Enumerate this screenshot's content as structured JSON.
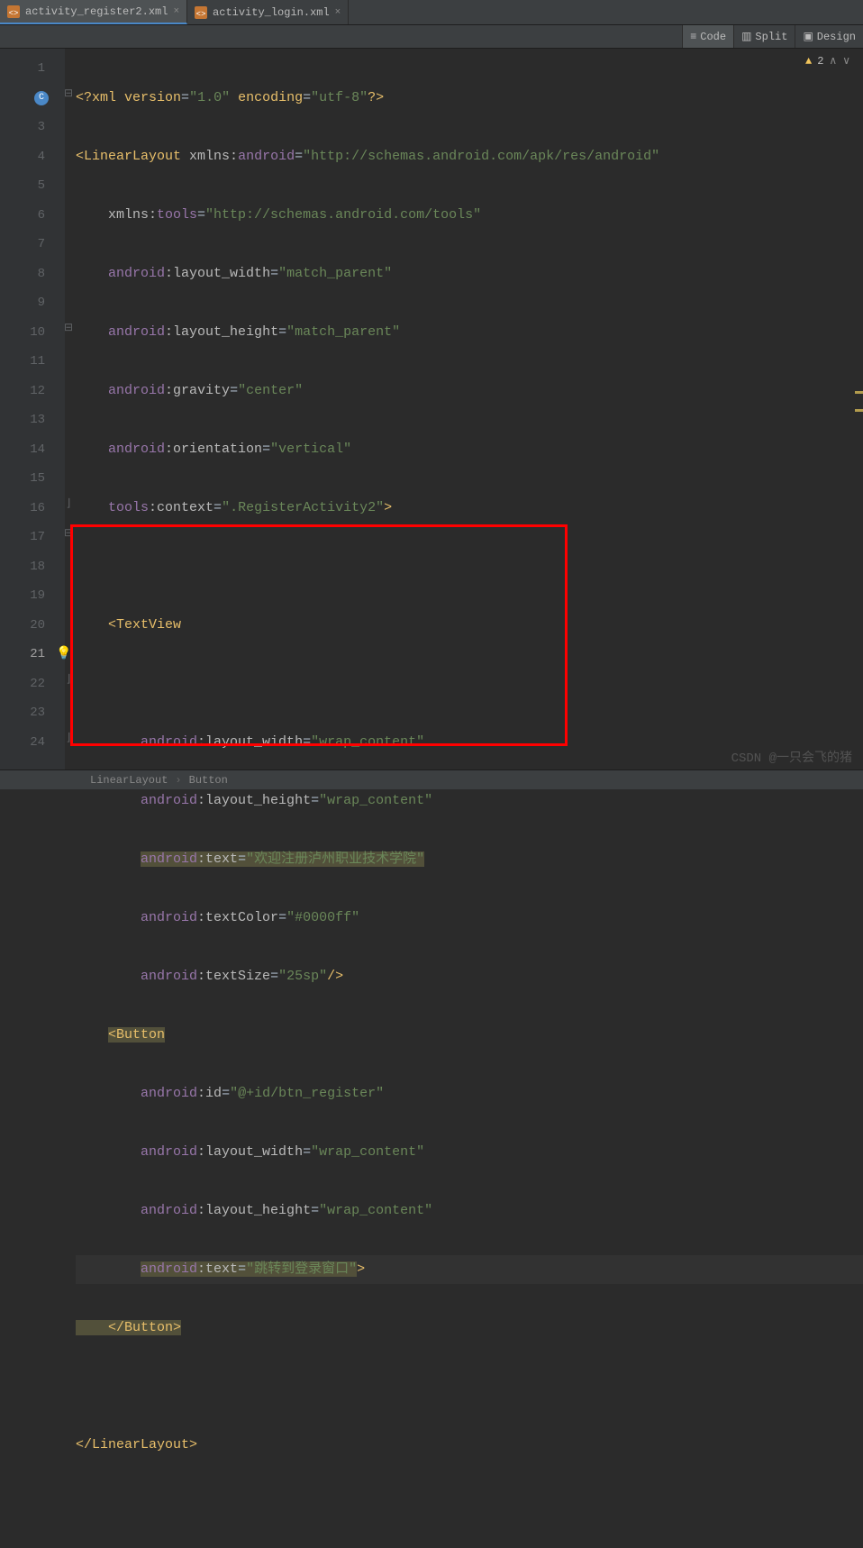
{
  "tabs": [
    {
      "label": "activity_register2.xml",
      "active": true
    },
    {
      "label": "activity_login.xml",
      "active": false
    }
  ],
  "views": {
    "code": "Code",
    "split": "Split",
    "design": "Design"
  },
  "warnings": {
    "count": "2"
  },
  "gutter": {
    "lines": [
      "1",
      "2",
      "3",
      "4",
      "5",
      "6",
      "7",
      "8",
      "9",
      "10",
      "11",
      "12",
      "13",
      "14",
      "15",
      "16",
      "17",
      "18",
      "19",
      "20",
      "21",
      "22",
      "23",
      "24"
    ],
    "currentLine": 21
  },
  "code": {
    "l1": {
      "p1": "<?",
      "p2": "xml version",
      "p3": "=",
      "p4": "\"1.0\"",
      "p5": " encoding",
      "p6": "=",
      "p7": "\"utf-8\"",
      "p8": "?>"
    },
    "l2": {
      "p1": "<",
      "p2": "LinearLayout ",
      "p3": "xmlns:",
      "p4": "android",
      "p5": "=",
      "p6": "\"http://schemas.android.com/apk/res/android\""
    },
    "l3": {
      "p1": "    xmlns:",
      "p2": "tools",
      "p3": "=",
      "p4": "\"http://schemas.android.com/tools\""
    },
    "l4": {
      "p1": "    android",
      "p2": ":",
      "p3": "layout_width",
      "p4": "=",
      "p5": "\"match_parent\""
    },
    "l5": {
      "p1": "    android",
      "p2": ":",
      "p3": "layout_height",
      "p4": "=",
      "p5": "\"match_parent\""
    },
    "l6": {
      "p1": "    android",
      "p2": ":",
      "p3": "gravity",
      "p4": "=",
      "p5": "\"center\""
    },
    "l7": {
      "p1": "    android",
      "p2": ":",
      "p3": "orientation",
      "p4": "=",
      "p5": "\"vertical\""
    },
    "l8": {
      "p1": "    tools",
      "p2": ":",
      "p3": "context",
      "p4": "=",
      "p5": "\".RegisterActivity2\"",
      "p6": ">"
    },
    "l10": {
      "p1": "    <",
      "p2": "TextView"
    },
    "l12": {
      "p1": "        android",
      "p2": ":",
      "p3": "layout_width",
      "p4": "=",
      "p5": "\"wrap_content\""
    },
    "l13": {
      "p1": "        android",
      "p2": ":",
      "p3": "layout_height",
      "p4": "=",
      "p5": "\"wrap_content\""
    },
    "l14": {
      "p1": "        ",
      "p2": "android",
      "p3": ":",
      "p4": "text",
      "p5": "=",
      "p6": "\"欢迎注册泸州职业技术学院\""
    },
    "l15": {
      "p1": "        android",
      "p2": ":",
      "p3": "textColor",
      "p4": "=",
      "p5": "\"#0000ff\""
    },
    "l16": {
      "p1": "        android",
      "p2": ":",
      "p3": "textSize",
      "p4": "=",
      "p5": "\"25sp\"",
      "p6": "/>"
    },
    "l17": {
      "p1": "    ",
      "p2": "<",
      "p3": "Button"
    },
    "l18": {
      "p1": "        android",
      "p2": ":",
      "p3": "id",
      "p4": "=",
      "p5": "\"@+id/btn_register\""
    },
    "l19": {
      "p1": "        android",
      "p2": ":",
      "p3": "layout_width",
      "p4": "=",
      "p5": "\"wrap_content\""
    },
    "l20": {
      "p1": "        android",
      "p2": ":",
      "p3": "layout_height",
      "p4": "=",
      "p5": "\"wrap_content\""
    },
    "l21": {
      "p1": "        ",
      "p2": "android",
      "p3": ":",
      "p4": "text",
      "p5": "=",
      "p6": "\"跳转到登录窗口\"",
      "p7": ">"
    },
    "l22": {
      "p1": "    </",
      "p2": "Button",
      "p3": ">"
    },
    "l24": {
      "p1": "</",
      "p2": "LinearLayout",
      "p3": ">"
    }
  },
  "breadcrumb": {
    "items": [
      "LinearLayout",
      "Button"
    ]
  },
  "watermark": "CSDN @一只会飞的猪"
}
